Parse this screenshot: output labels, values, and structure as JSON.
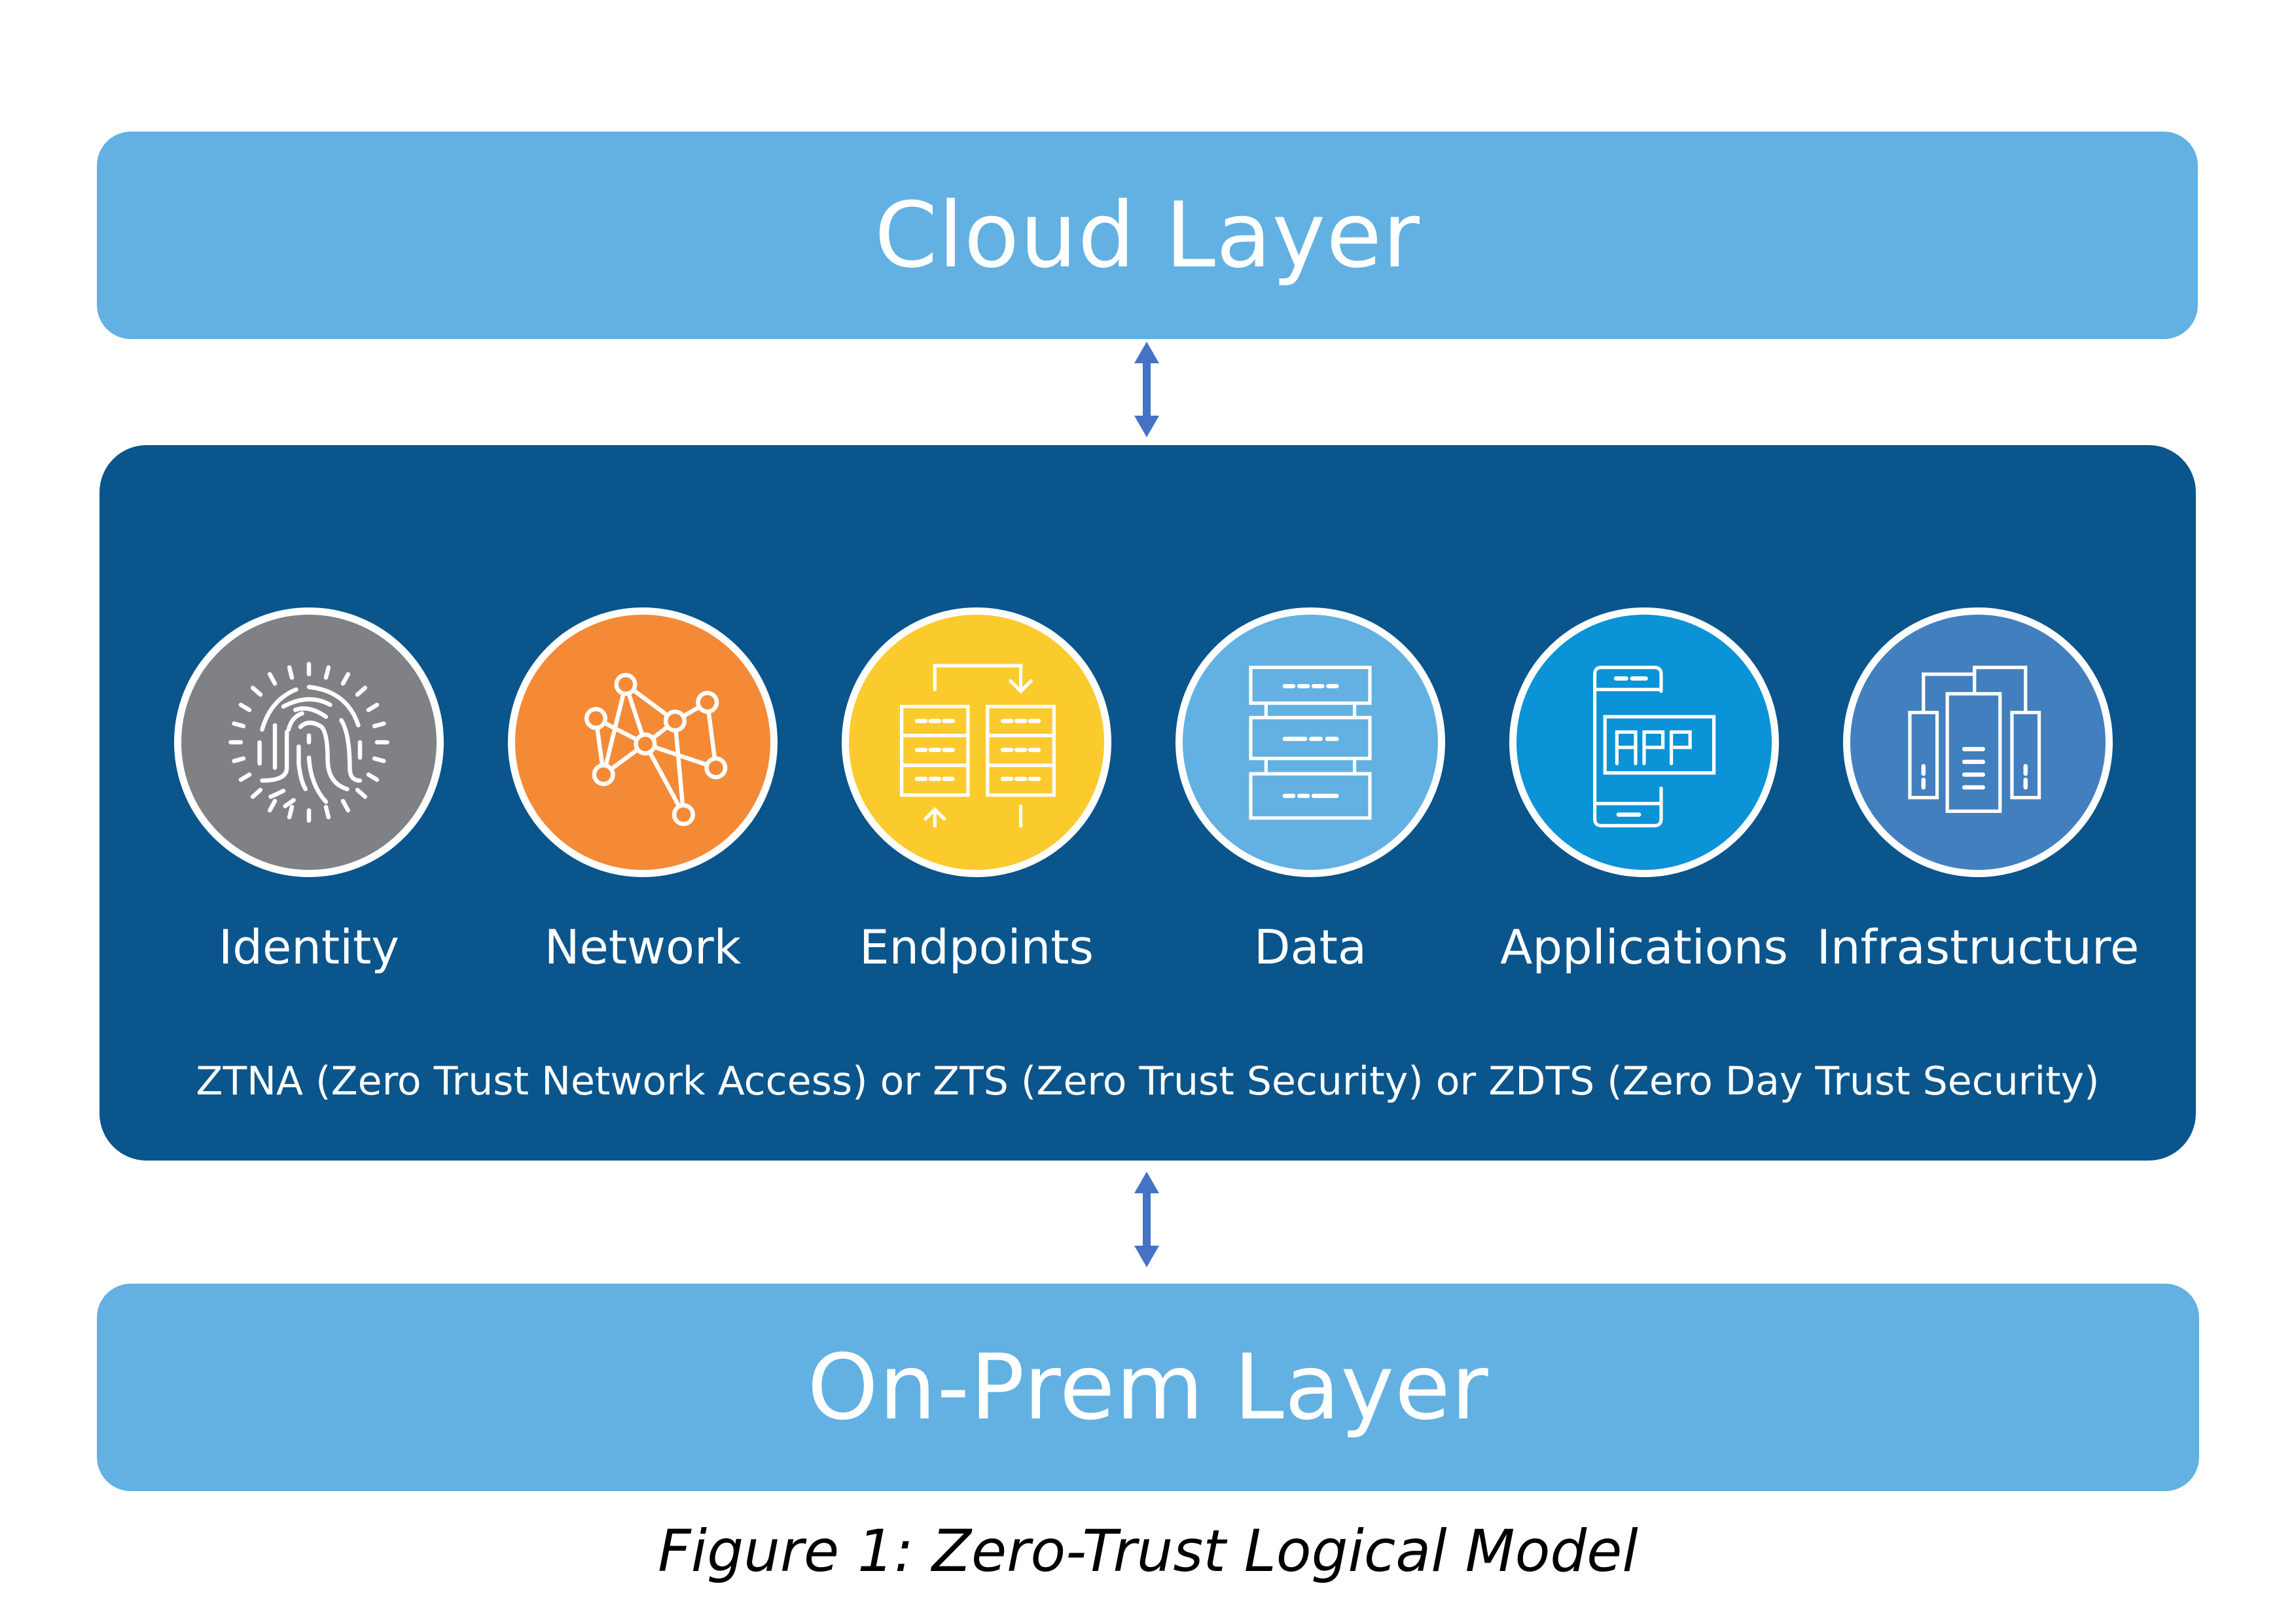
{
  "diagram": {
    "cloud_layer": {
      "title": "Cloud Layer"
    },
    "core": {
      "pillars": [
        {
          "label": "Identity",
          "icon": "fingerprint-icon",
          "color": "#808184"
        },
        {
          "label": "Network",
          "icon": "network-nodes-icon",
          "color": "#f48a36"
        },
        {
          "label": "Endpoints",
          "icon": "server-sync-icon",
          "color": "#fbcb2e"
        },
        {
          "label": "Data",
          "icon": "database-stack-icon",
          "color": "#62b1e2"
        },
        {
          "label": "Applications",
          "icon": "mobile-app-icon",
          "color": "#0a93d6"
        },
        {
          "label": "Infrastructure",
          "icon": "server-towers-icon",
          "color": "#427fbe"
        }
      ],
      "subtitle": "ZTNA (Zero Trust Network Access) or ZTS (Zero Trust Security) or ZDTS (Zero Day Trust Security)"
    },
    "onprem_layer": {
      "title": "On-Prem Layer"
    },
    "caption": "Figure 1: Zero-Trust Logical Model",
    "colors": {
      "layer_fill": "#62b1e2",
      "core_fill": "#0a558c",
      "arrow": "#4472c4",
      "text_on_fill": "#ffffff"
    }
  }
}
